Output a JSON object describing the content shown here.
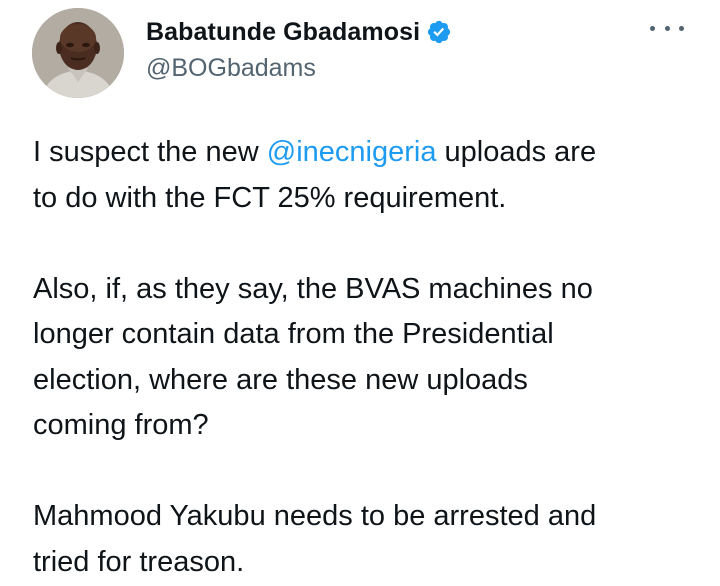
{
  "author": {
    "display_name": "Babatunde Gbadamosi",
    "handle": "@BOGbadams",
    "verified": true
  },
  "colors": {
    "text": "#0f1419",
    "secondary": "#536471",
    "link": "#1d9bf0",
    "verified_badge": "#1d9bf0"
  },
  "icons": {
    "verified": "verified-badge-icon",
    "more": "more-options-icon"
  },
  "tweet": {
    "p1_before": "I suspect the new ",
    "p1_mention": "@inecnigeria",
    "p1_line1_after": " uploads are",
    "p1_line2": "to do with the FCT 25% requirement.",
    "p2_line1": "Also, if, as they say, the BVAS machines no",
    "p2_line2": "longer contain data from the Presidential",
    "p2_line3": "election, where are these new uploads",
    "p2_line4": "coming from?",
    "p3_line1": "Mahmood Yakubu needs to be arrested and",
    "p3_line2": "tried for treason."
  }
}
